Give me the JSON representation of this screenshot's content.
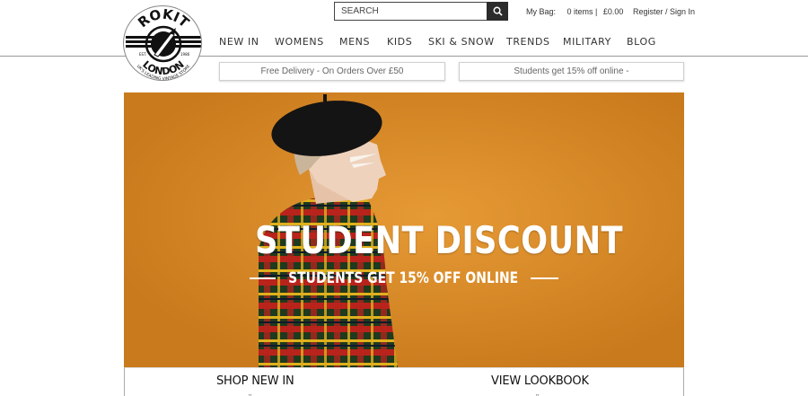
{
  "logo": {
    "brand_top": "ROKIT",
    "brand_bottom": "LONDON",
    "tagline": "UK'S LEADING VINTAGE STORE",
    "est": "EST.",
    "year": "1986"
  },
  "search": {
    "placeholder": "SEARCH",
    "icon": "search-icon"
  },
  "bag": {
    "label": "My Bag:",
    "items": "0 items |",
    "total": "£0.00"
  },
  "account": {
    "register_label": "Register / Sign In"
  },
  "nav": {
    "items": [
      "NEW IN",
      "WOMENS",
      "MENS",
      "KIDS",
      "SKI & SNOW",
      "TRENDS",
      "MILITARY",
      "BLOG"
    ]
  },
  "promos": {
    "delivery": "Free Delivery - On Orders Over £50",
    "students": "Students get 15% off online -"
  },
  "hero": {
    "title": "STUDENT DISCOUNT",
    "subtitle": "STUDENTS GET 15% OFF ONLINE",
    "background_color": "#d98a27"
  },
  "ctas": {
    "shop_new_in": "SHOP NEW IN",
    "view_lookbook": "VIEW LOOKBOOK"
  },
  "colors": {
    "accent": "#2b2b2b",
    "hero_orange": "#d98a27"
  }
}
